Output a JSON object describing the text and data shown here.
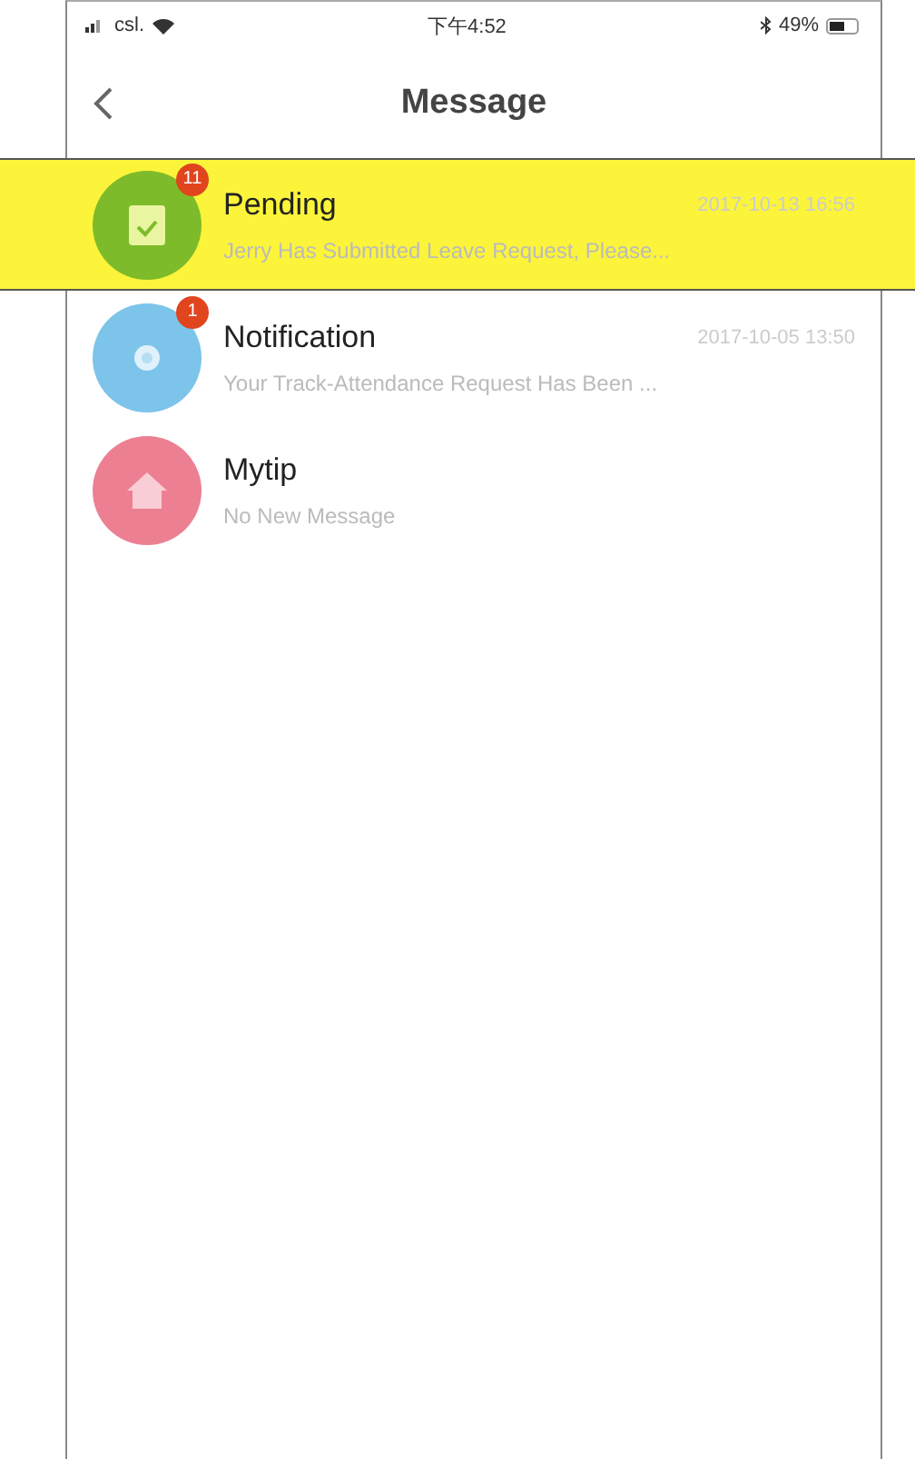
{
  "status_bar": {
    "carrier": "csl.",
    "time": "下午4:52",
    "battery": "49%"
  },
  "nav": {
    "title": "Message"
  },
  "messages": [
    {
      "kind": "pending",
      "title": "Pending",
      "time": "2017-10-13 16:56",
      "preview": "Jerry Has Submitted Leave Request, Please...",
      "badge": "11",
      "selected": true,
      "color": "#7dbb2a"
    },
    {
      "kind": "notification",
      "title": "Notification",
      "time": "2017-10-05 13:50",
      "preview": "Your Track-Attendance Request Has Been ...",
      "badge": "1",
      "selected": false,
      "color": "#7cc4ea"
    },
    {
      "kind": "mytip",
      "title": "Mytip",
      "preview": "No New Message",
      "selected": false,
      "color": "#ec8092"
    }
  ]
}
